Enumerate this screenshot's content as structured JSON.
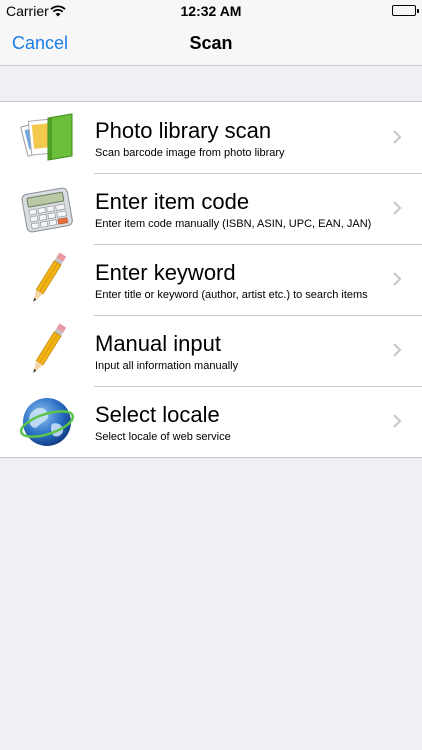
{
  "status_bar": {
    "carrier": "Carrier",
    "time": "12:32 AM"
  },
  "nav": {
    "cancel_label": "Cancel",
    "title": "Scan"
  },
  "rows": [
    {
      "icon": "photo-library-icon",
      "title": "Photo library scan",
      "subtitle": "Scan barcode image from photo library"
    },
    {
      "icon": "calculator-icon",
      "title": "Enter item code",
      "subtitle": "Enter item code manually (ISBN, ASIN, UPC, EAN, JAN)"
    },
    {
      "icon": "pencil-icon",
      "title": "Enter keyword",
      "subtitle": "Enter title or keyword (author, artist etc.) to search items"
    },
    {
      "icon": "pencil-icon",
      "title": "Manual input",
      "subtitle": "Input all information manually"
    },
    {
      "icon": "globe-icon",
      "title": "Select locale",
      "subtitle": "Select locale of web service"
    }
  ],
  "colors": {
    "accent": "#1a7ee6",
    "background": "#efeff4",
    "separator": "#c8c7cc"
  }
}
